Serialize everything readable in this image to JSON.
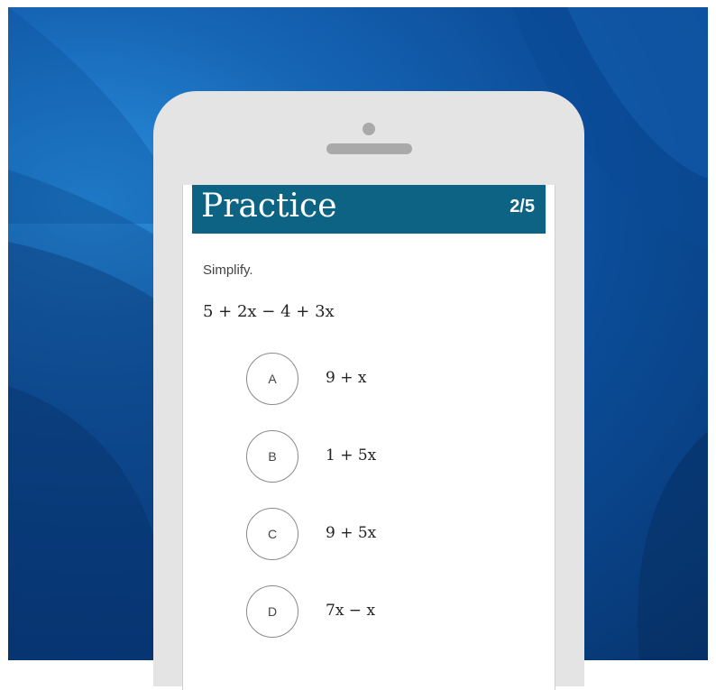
{
  "colors": {
    "header_bg": "#0d6384",
    "header_text": "#ffffff",
    "phone_body": "#e4e4e4",
    "background_blue": "#1665b5"
  },
  "header": {
    "title": "Practice",
    "progress": "2/5"
  },
  "question": {
    "prompt": "Simplify.",
    "expression": "5 + 2x − 4 + 3x"
  },
  "options": [
    {
      "letter": "A",
      "answer": "9 + x"
    },
    {
      "letter": "B",
      "answer": "1 + 5x"
    },
    {
      "letter": "C",
      "answer": "9 + 5x"
    },
    {
      "letter": "D",
      "answer": "7x − x"
    }
  ]
}
